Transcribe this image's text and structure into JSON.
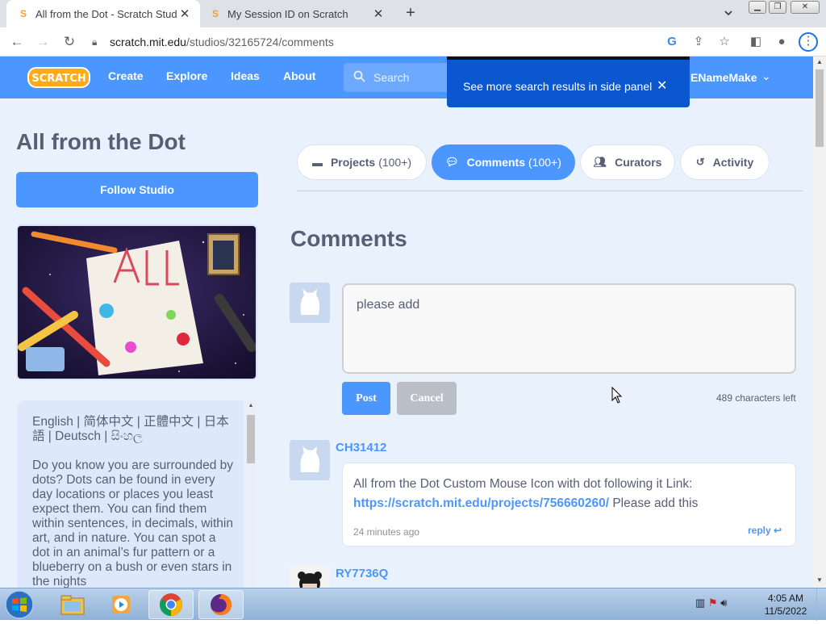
{
  "browser": {
    "tabs": [
      {
        "title": "All from the Dot - Scratch Studio",
        "active": true
      },
      {
        "title": "My Session ID on Scratch",
        "active": false
      }
    ],
    "url_host": "scratch.mit.edu",
    "url_path": "/studios/32165724/comments"
  },
  "scratch_nav": {
    "links": [
      "Create",
      "Explore",
      "Ideas",
      "About"
    ],
    "search_placeholder": "Search",
    "username": "ENameMake"
  },
  "popup": {
    "text": "See more search results in side panel"
  },
  "studio": {
    "title": "All from the Dot",
    "follow_label": "Follow Studio",
    "description_lines": [
      "English | 简体中文 | 正體中文 | 日本語 | Deutsch | සිංහල",
      "Do you know you are surrounded by dots? Dots can be found in every day locations or places you least expect them. You can find them within sentences, in decimals, within art, and in nature. You can spot a dot in an animal’s fur pattern or a blueberry on a bush or even stars in the nights"
    ]
  },
  "studio_tabs": [
    {
      "label": "Projects",
      "count": "(100+)",
      "icon": "projects-icon"
    },
    {
      "label": "Comments",
      "count": "(100+)",
      "icon": "comment-icon"
    },
    {
      "label": "Curators",
      "count": "",
      "icon": "people-icon"
    },
    {
      "label": "Activity",
      "count": "",
      "icon": "history-icon"
    }
  ],
  "comments": {
    "heading": "Comments",
    "compose_value": "please add",
    "post_label": "Post",
    "cancel_label": "Cancel",
    "chars_left": "489 characters left",
    "items": [
      {
        "author": "CH31412",
        "text_before": "All from the Dot Custom Mouse Icon with dot following it Link: ",
        "link": "https://scratch.mit.edu/projects/756660260/",
        "text_after": " Please add this",
        "time": "24 minutes ago",
        "reply_label": "reply"
      },
      {
        "author": "RY7736Q"
      }
    ]
  },
  "taskbar": {
    "time": "4:05 AM",
    "date": "11/5/2022"
  },
  "colors": {
    "scratch_blue": "#4c97ff",
    "text_gray": "#575e75",
    "page_bg": "#e9f1fc",
    "popup_blue": "#0b57d0"
  }
}
